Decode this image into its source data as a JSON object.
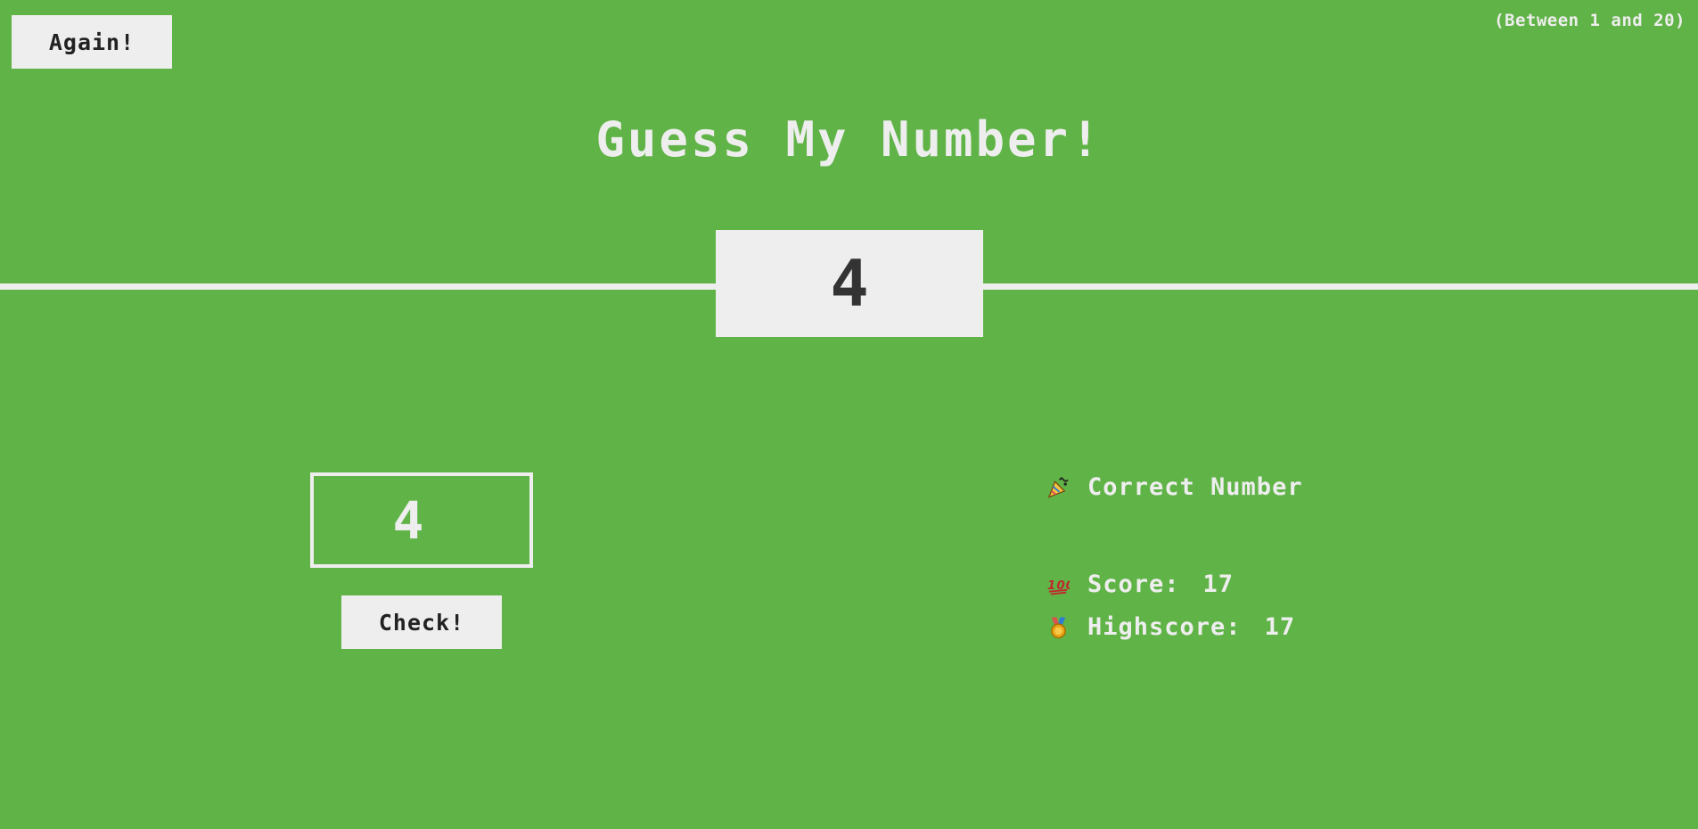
{
  "header": {
    "again_label": "Again!",
    "between_text": "(Between 1 and 20)",
    "title": "Guess My Number!"
  },
  "secret_number": "4",
  "left": {
    "guess_value": "4",
    "check_label": "Check!"
  },
  "right": {
    "message": "Correct Number",
    "message_icon": "party-popper-icon",
    "score_label": "Score:",
    "score_value": "17",
    "score_icon": "hundred-points-icon",
    "highscore_label": "Highscore:",
    "highscore_value": "17",
    "highscore_icon": "medal-icon"
  },
  "colors": {
    "background": "#60b347",
    "foreground": "#eeeeee",
    "dark_text": "#333333"
  }
}
